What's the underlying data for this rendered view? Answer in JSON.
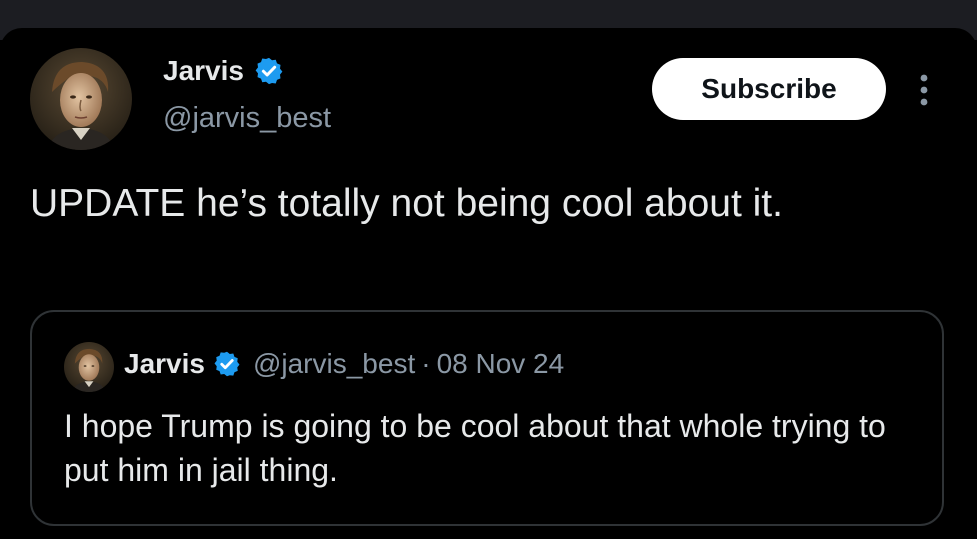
{
  "post": {
    "author": {
      "display_name": "Jarvis",
      "handle": "@jarvis_best",
      "verified": true,
      "avatar_icon": "portrait-avatar"
    },
    "subscribe_label": "Subscribe",
    "more_icon": "more-vertical-icon",
    "text": "UPDATE he’s totally not being cool about it."
  },
  "quoted_post": {
    "author": {
      "display_name": "Jarvis",
      "handle": "@jarvis_best",
      "verified": true,
      "avatar_icon": "portrait-avatar"
    },
    "separator": "·",
    "date": "08 Nov 24",
    "text": "I hope Trump is going to be cool about that whole trying to put him in jail thing."
  },
  "colors": {
    "background": "#000000",
    "top_strip": "#1c1d22",
    "verified_badge": "#1d9bf0",
    "text_primary": "#e7e9ea",
    "text_secondary": "#8b98a5",
    "border": "#2f3336",
    "button_bg": "#ffffff",
    "button_text": "#0f1419"
  }
}
